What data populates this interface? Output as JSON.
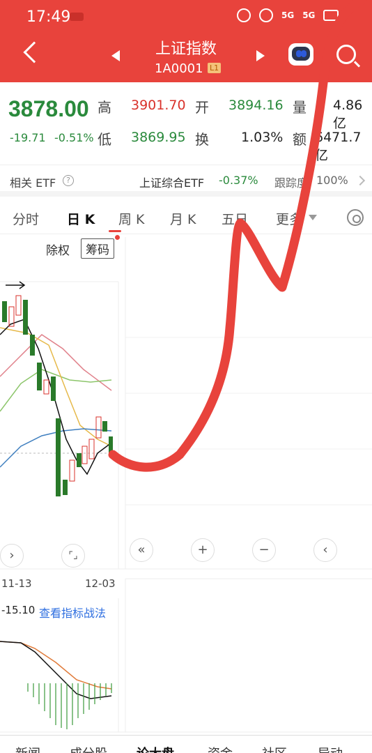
{
  "status": {
    "time": "17:49",
    "signal_label_1": "5G",
    "signal_label_2": "5G"
  },
  "header": {
    "title": "上证指数",
    "code": "1A0001",
    "level_badge": "L1"
  },
  "quote": {
    "price": "3878.00",
    "change": "-19.71",
    "change_pct": "-0.51%",
    "high_label": "高",
    "high": "3901.70",
    "open_label": "开",
    "open": "3894.16",
    "volume_label": "量",
    "volume": "4.86亿",
    "low_label": "低",
    "low": "3869.95",
    "turnover_label": "换",
    "turnover": "1.03%",
    "amount_label": "额",
    "amount": "6471.7亿"
  },
  "etf": {
    "label": "相关 ETF",
    "name": "上证综合ETF",
    "change": "-0.37%",
    "tracking_label": "跟踪度",
    "tracking": "100%"
  },
  "tabs": [
    "分时",
    "日 K",
    "周 K",
    "月 K",
    "五日",
    "更多"
  ],
  "chart_controls": {
    "fq_label": "除权",
    "chip_label": "筹码"
  },
  "dates": {
    "start": "11-13",
    "end": "12-03"
  },
  "indicator": {
    "value": "-15.10",
    "link": "查看指标战法"
  },
  "bottom_nav": [
    "新闻",
    "成分股",
    "资金",
    "社区",
    "异动"
  ],
  "bottom_nav_active": "论大盘",
  "colors": {
    "up": "#d9322b",
    "down": "#2a8a3c",
    "header": "#e8433c",
    "annotation": "#e8433c"
  }
}
